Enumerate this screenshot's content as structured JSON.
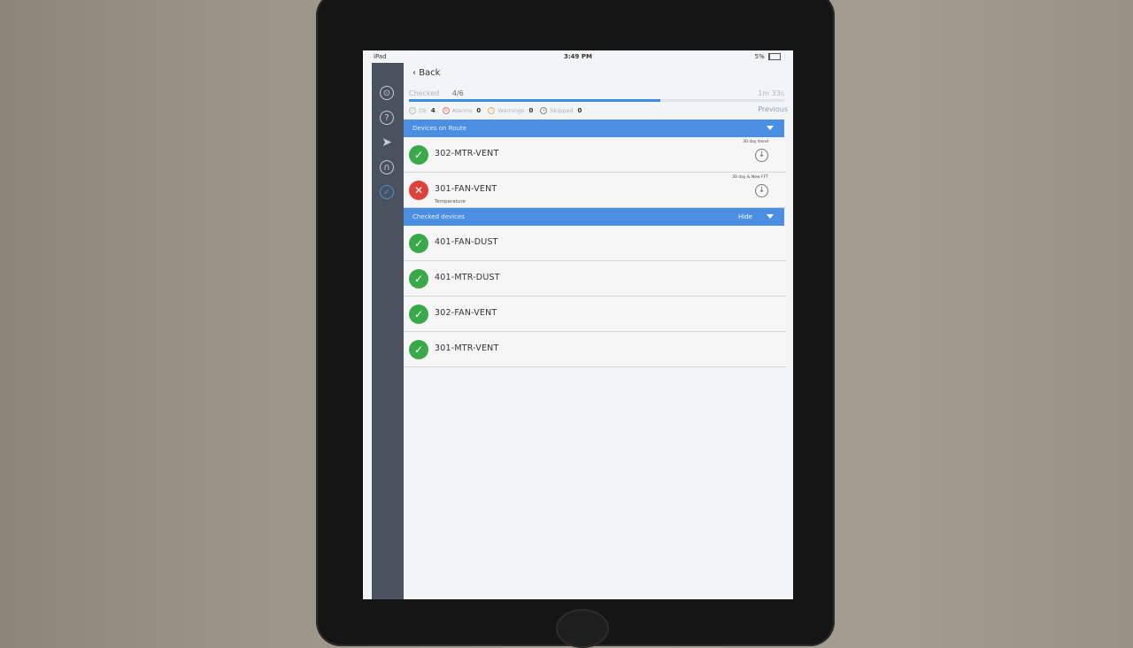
{
  "status_bar": {
    "device": "iPad",
    "time": "3:49 PM",
    "battery": "5%"
  },
  "sidebar": {
    "icons": [
      "antenna-icon",
      "help-icon",
      "send-icon",
      "headset-icon",
      "check-circle-icon"
    ],
    "active_index": 4
  },
  "header": {
    "back_label": "Back"
  },
  "progress": {
    "label": "Checked",
    "count": "4/6",
    "fraction": 0.67,
    "timer": "1m 33s",
    "previous_label": "Previous"
  },
  "stats": {
    "ok_label": "Ok",
    "ok_count": "4",
    "alarms_label": "Alarms",
    "alarms_count": "0",
    "warnings_label": "Warnings",
    "warnings_count": "0",
    "skipped_label": "Skipped",
    "skipped_count": "0"
  },
  "sections": {
    "on_route": {
      "title": "Devices on Route",
      "devices": [
        {
          "name": "302-MTR-VENT",
          "status": "ok",
          "trend_label": "30 day trend",
          "subtitle": ""
        },
        {
          "name": "301-FAN-VENT",
          "status": "alarm",
          "trend_label": "30 day & New FFT",
          "subtitle": "Temperature"
        }
      ]
    },
    "checked": {
      "title": "Checked devices",
      "hide_label": "Hide",
      "devices": [
        {
          "name": "401-FAN-DUST",
          "status": "ok"
        },
        {
          "name": "401-MTR-DUST",
          "status": "ok"
        },
        {
          "name": "302-FAN-VENT",
          "status": "ok"
        },
        {
          "name": "301-MTR-VENT",
          "status": "ok"
        }
      ]
    }
  },
  "colors": {
    "accent": "#4a8fe2",
    "ok": "#3aaa48",
    "alarm": "#e0403a",
    "sidebar": "#4a5260"
  }
}
